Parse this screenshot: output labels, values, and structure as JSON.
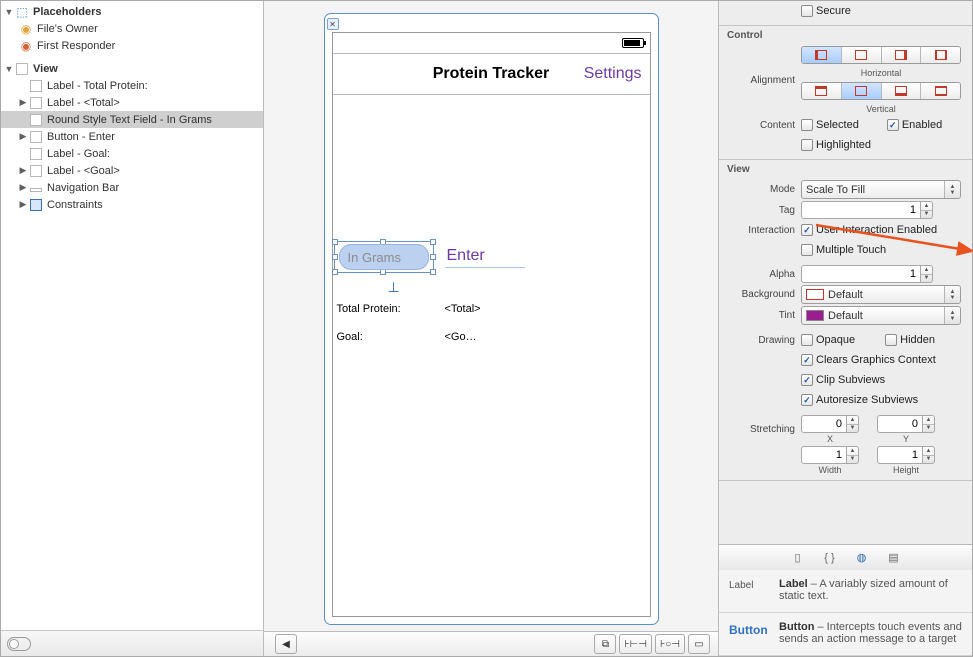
{
  "outline": {
    "placeholders_title": "Placeholders",
    "files_owner": "File's Owner",
    "first_responder": "First Responder",
    "view_title": "View",
    "items": [
      "Label - Total Protein:",
      "Label - <Total>",
      "Round Style Text Field - In Grams",
      "Button - Enter",
      "Label - Goal:",
      "Label - <Goal>",
      "Navigation Bar",
      "Constraints"
    ]
  },
  "canvas": {
    "nav_title": "Protein Tracker",
    "nav_settings": "Settings",
    "textfield_placeholder": "In Grams",
    "enter_label": "Enter",
    "total_protein_label": "Total Protein:",
    "total_value": "<Total>",
    "goal_label": "Goal:",
    "goal_value": "<Go…"
  },
  "insp": {
    "secure": "Secure",
    "control_title": "Control",
    "alignment": "Alignment",
    "horizontal": "Horizontal",
    "vertical": "Vertical",
    "content": "Content",
    "selected": "Selected",
    "enabled": "Enabled",
    "highlighted": "Highlighted",
    "view_title": "View",
    "mode": "Mode",
    "mode_val": "Scale To Fill",
    "tag": "Tag",
    "tag_val": "1",
    "interaction": "Interaction",
    "uie": "User Interaction Enabled",
    "mtouch": "Multiple Touch",
    "alpha": "Alpha",
    "alpha_val": "1",
    "background": "Background",
    "bg_val": "Default",
    "tint": "Tint",
    "tint_val": "Default",
    "drawing": "Drawing",
    "opaque": "Opaque",
    "hidden": "Hidden",
    "cgc": "Clears Graphics Context",
    "cs": "Clip Subviews",
    "as": "Autoresize Subviews",
    "stretching": "Stretching",
    "zero": "0",
    "one": "1",
    "x": "X",
    "y": "Y",
    "w": "Width",
    "h": "Height"
  },
  "lib": {
    "label_name": "Label",
    "label_title": "Label",
    "label_desc": " – A variably sized amount of static text.",
    "button_name": "Button",
    "button_title": "Button",
    "button_desc": " – Intercepts touch events and sends an action message to a target"
  }
}
